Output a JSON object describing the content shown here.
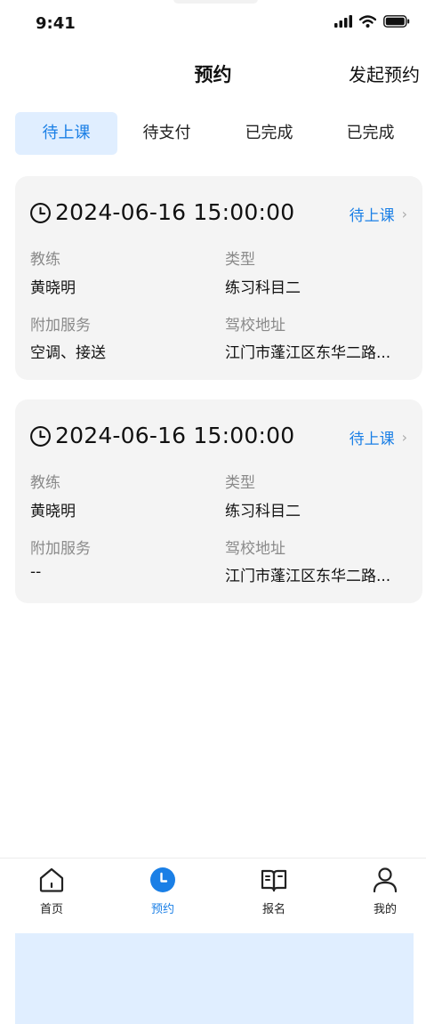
{
  "status_bar": {
    "time": "9:41"
  },
  "header": {
    "title": "预约",
    "action_label": "发起预约"
  },
  "tabs": [
    {
      "label": "待上课",
      "active": true
    },
    {
      "label": "待支付",
      "active": false
    },
    {
      "label": "已完成",
      "active": false
    },
    {
      "label": "已完成",
      "active": false
    }
  ],
  "cards": [
    {
      "datetime": "2024-06-16 15:00:00",
      "status": "待上课",
      "coach_label": "教练",
      "coach": "黄晓明",
      "type_label": "类型",
      "type": "练习科目二",
      "service_label": "附加服务",
      "service": "空调、接送",
      "address_label": "驾校地址",
      "address": "江门市蓬江区东华二路..."
    },
    {
      "datetime": "2024-06-16 15:00:00",
      "status": "待上课",
      "coach_label": "教练",
      "coach": "黄晓明",
      "type_label": "类型",
      "type": "练习科目二",
      "service_label": "附加服务",
      "service": "--",
      "address_label": "驾校地址",
      "address": "江门市蓬江区东华二路..."
    }
  ],
  "tabbar": [
    {
      "label": "首页",
      "icon": "home-icon",
      "active": false
    },
    {
      "label": "预约",
      "icon": "clock-icon",
      "active": true
    },
    {
      "label": "报名",
      "icon": "book-icon",
      "active": false
    },
    {
      "label": "我的",
      "icon": "user-icon",
      "active": false
    }
  ],
  "colors": {
    "accent": "#1a7fe6",
    "tab_active_bg": "#e0eeff",
    "card_bg": "#f4f4f4"
  }
}
